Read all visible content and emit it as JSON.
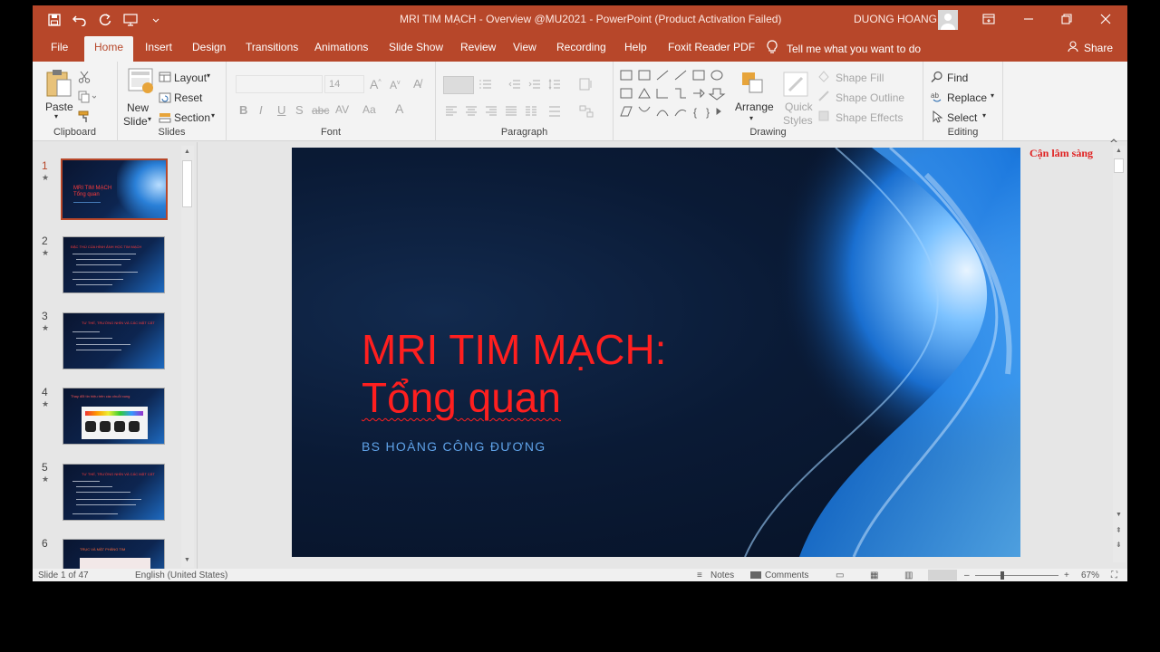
{
  "window": {
    "title": "MRI TIM MẠCH - Overview @MU2021  -  PowerPoint (Product Activation Failed)",
    "user": "DUONG HOANG"
  },
  "tabs": [
    "File",
    "Home",
    "Insert",
    "Design",
    "Transitions",
    "Animations",
    "Slide Show",
    "Review",
    "View",
    "Recording",
    "Help",
    "Foxit Reader PDF"
  ],
  "active_tab": "Home",
  "tellme": "Tell me what you want to do",
  "share": "Share",
  "ribbon": {
    "clipboard": {
      "label": "Clipboard",
      "paste": "Paste"
    },
    "slides": {
      "label": "Slides",
      "new_slide_1": "New",
      "new_slide_2": "Slide",
      "layout": "Layout",
      "reset": "Reset",
      "section": "Section"
    },
    "font": {
      "label": "Font",
      "size": "14"
    },
    "paragraph": {
      "label": "Paragraph"
    },
    "drawing": {
      "label": "Drawing",
      "arrange": "Arrange",
      "quick_1": "Quick",
      "quick_2": "Styles",
      "shape_fill": "Shape Fill",
      "shape_outline": "Shape Outline",
      "shape_effects": "Shape Effects"
    },
    "editing": {
      "label": "Editing",
      "find": "Find",
      "replace": "Replace",
      "select": "Select"
    }
  },
  "thumbnails": [
    {
      "num": "1",
      "title": "MRI TIM MẠCH",
      "sub": "Tổng quan"
    },
    {
      "num": "2",
      "title": "ĐẶC THÙ CỦA HÌNH ẢNH HỌC TIM MẠCH"
    },
    {
      "num": "3",
      "title": "TƯ THẾ, TRƯỜNG NHÌN VÀ CÁC MẶT CẮT"
    },
    {
      "num": "4",
      "title": "Thay đổi tín hiệu trên các chuỗi xung"
    },
    {
      "num": "5",
      "title": "TƯ THẾ, TRƯỜNG NHÌN VÀ CÁC MẶT CẮT"
    },
    {
      "num": "6",
      "title": "TRỤC VÀ MẶT PHẲNG TIM"
    }
  ],
  "slide": {
    "title_line1": "MRI TIM MẠCH:",
    "title_line2": "Tổng quan",
    "subtitle": "BS HOÀNG CÔNG ĐƯƠNG"
  },
  "watermark": "Cận lâm sàng",
  "status": {
    "slide_of": "Slide 1 of 47",
    "language": "English (United States)",
    "notes": "Notes",
    "comments": "Comments",
    "zoom": "67%"
  },
  "colors": {
    "accent": "#b7472a",
    "title_red": "#ff1f1f",
    "subtitle_blue": "#5fa2e8"
  }
}
